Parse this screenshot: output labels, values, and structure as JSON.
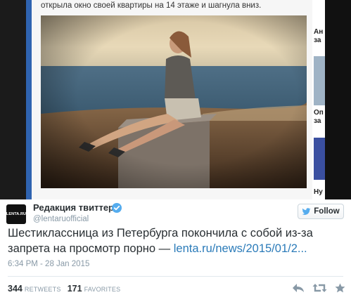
{
  "article": {
    "caption": "открыла окно своей квартиры на 14 этаже и шагнула вниз.",
    "side_snippets": [
      "Ан",
      "за",
      "Оп",
      "за",
      "Ну"
    ]
  },
  "tweet": {
    "avatar_text": "LENTA.RU",
    "display_name": "Редакция твиттера",
    "handle": "@lentaruofficial",
    "follow_label": "Follow",
    "text": "Шестиклассница из Петербурга покончила с собой из-за запрета на просмотр порно — ",
    "link_text": "lenta.ru/news/2015/01/2...",
    "timestamp": "6:34 PM - 28 Jan 2015",
    "retweets_count": "344",
    "retweets_label": "RETWEETS",
    "favorites_count": "171",
    "favorites_label": "FAVORITES"
  },
  "icons": {
    "verified": "verified-badge-icon",
    "follow": "twitter-bird-icon",
    "reply": "reply-icon",
    "retweet": "retweet-icon",
    "favorite": "star-icon"
  },
  "colors": {
    "link": "#2b7bb9",
    "verified": "#55acee",
    "muted": "#8899a6",
    "text": "#292f33"
  }
}
